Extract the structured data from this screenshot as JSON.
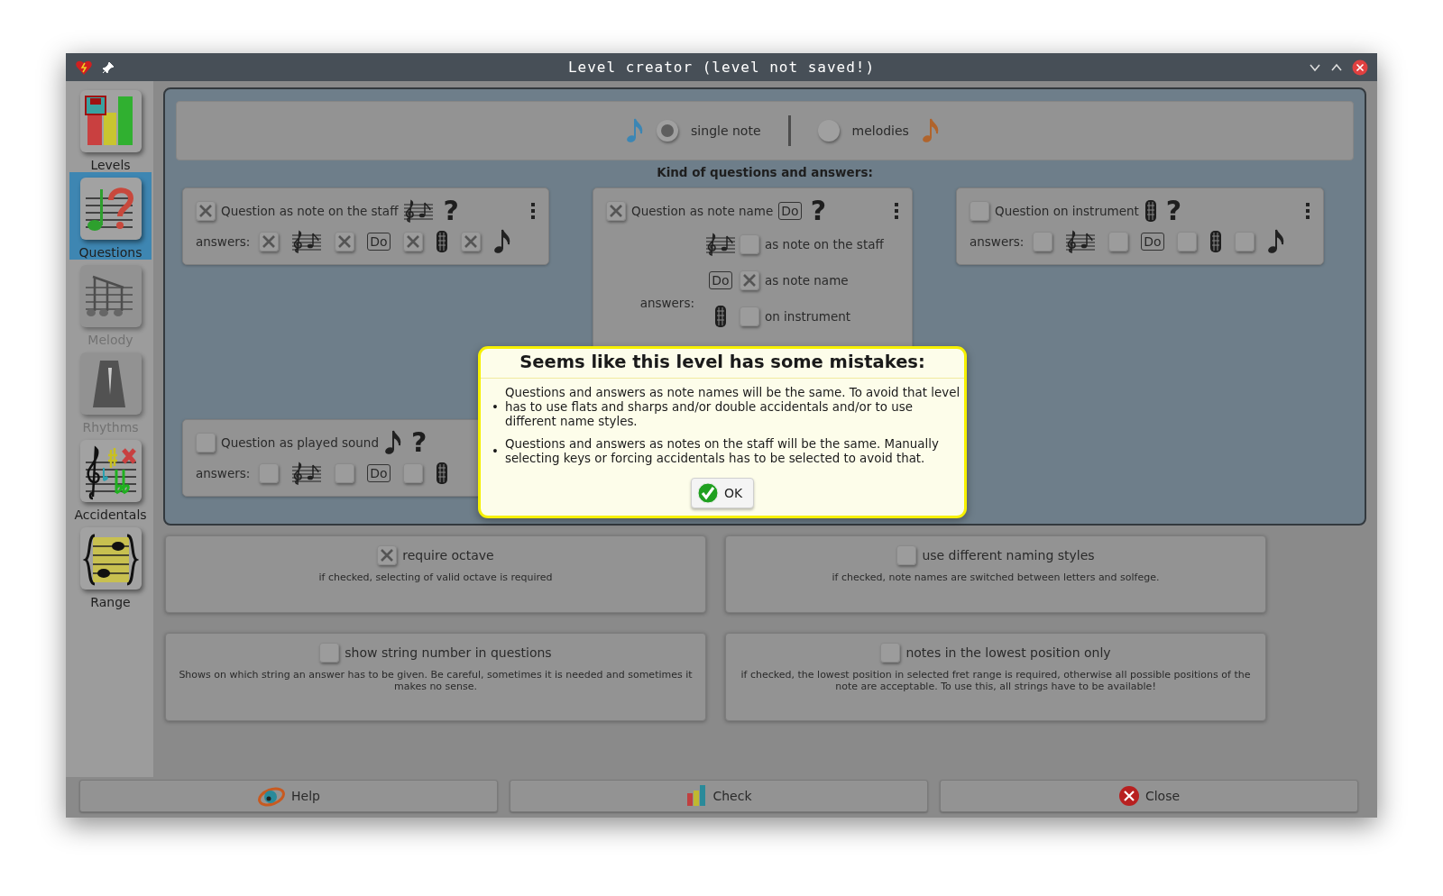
{
  "window": {
    "title": "Level creator (level not saved!)"
  },
  "sidebar": {
    "items": [
      {
        "label": "Levels",
        "selected": false,
        "disabled": false
      },
      {
        "label": "Questions",
        "selected": true,
        "disabled": false
      },
      {
        "label": "Melody",
        "selected": false,
        "disabled": true
      },
      {
        "label": "Rhythms",
        "selected": false,
        "disabled": true
      },
      {
        "label": "Accidentals",
        "selected": false,
        "disabled": false
      },
      {
        "label": "Range",
        "selected": false,
        "disabled": false
      }
    ]
  },
  "mode": {
    "options": [
      {
        "label": "single note",
        "selected": true
      },
      {
        "label": "melodies",
        "selected": false
      }
    ]
  },
  "questions": {
    "heading": "Kind of questions and answers:",
    "cards": [
      {
        "kind": "row",
        "checked": true,
        "label": "Question as note on the staff",
        "icon": {
          "kind": "staff"
        },
        "question_mark": "?",
        "menu": true,
        "answers_label": "answers:",
        "answers": [
          {
            "kind": "staff",
            "checked": true
          },
          {
            "kind": "name",
            "text": "Do",
            "checked": true
          },
          {
            "kind": "instrument",
            "checked": true
          },
          {
            "kind": "sound",
            "checked": true
          }
        ]
      },
      {
        "kind": "list",
        "checked": true,
        "label": "Question as note name",
        "icon": {
          "kind": "name",
          "text": "Do"
        },
        "question_mark": "?",
        "menu": true,
        "answers_label": "answers:",
        "answers": [
          {
            "kind": "staff",
            "checked": false,
            "label": "as note on the staff"
          },
          {
            "kind": "name",
            "text": "Do",
            "checked": true,
            "label": "as note name"
          },
          {
            "kind": "instrument",
            "checked": false,
            "label": "on instrument"
          }
        ]
      },
      {
        "kind": "row",
        "checked": false,
        "label": "Question on instrument",
        "icon": {
          "kind": "instrument"
        },
        "question_mark": "?",
        "menu": true,
        "answers_label": "answers:",
        "answers": [
          {
            "kind": "staff",
            "checked": false
          },
          {
            "kind": "name",
            "text": "Do",
            "checked": false
          },
          {
            "kind": "instrument",
            "checked": false
          },
          {
            "kind": "sound",
            "checked": false
          }
        ]
      },
      {
        "kind": "row",
        "checked": false,
        "label": "Question as played sound",
        "icon": {
          "kind": "sound"
        },
        "question_mark": "?",
        "menu": false,
        "answers_label": "answers:",
        "answers": [
          {
            "kind": "staff",
            "checked": false
          },
          {
            "kind": "name",
            "text": "Do",
            "checked": false
          },
          {
            "kind": "instrument",
            "checked": false
          }
        ]
      }
    ]
  },
  "options": [
    {
      "label": "require octave",
      "checked": true,
      "description": "if checked, selecting of valid octave is required"
    },
    {
      "label": "use different naming styles",
      "checked": false,
      "description": "if checked, note names are switched between letters and solfege."
    },
    {
      "label": "show string number in questions",
      "checked": false,
      "description": "Shows on which string an answer has to be given. Be careful, sometimes it is needed and sometimes it makes no sense."
    },
    {
      "label": "notes in the lowest position only",
      "checked": false,
      "description": "if checked, the lowest position in selected fret range is required, otherwise all possible positions of the note are acceptable. To use this, all strings have to be available!"
    }
  ],
  "buttons": [
    {
      "kind": "help",
      "label": "Help"
    },
    {
      "kind": "check",
      "label": "Check"
    },
    {
      "kind": "close",
      "label": "Close"
    }
  ],
  "dialog": {
    "title": "Seems like this level has some mistakes:",
    "messages": [
      {
        "bullet": "•",
        "text": "Questions and answers as note names will be the same. To avoid that level has to use flats and sharps and/or double accidentals and/or to use different name styles."
      },
      {
        "bullet": "•",
        "text": "Questions and answers as notes on the staff will be the same. Manually selecting keys or forcing accidentals has to be selected to avoid that."
      }
    ],
    "button": "OK"
  }
}
